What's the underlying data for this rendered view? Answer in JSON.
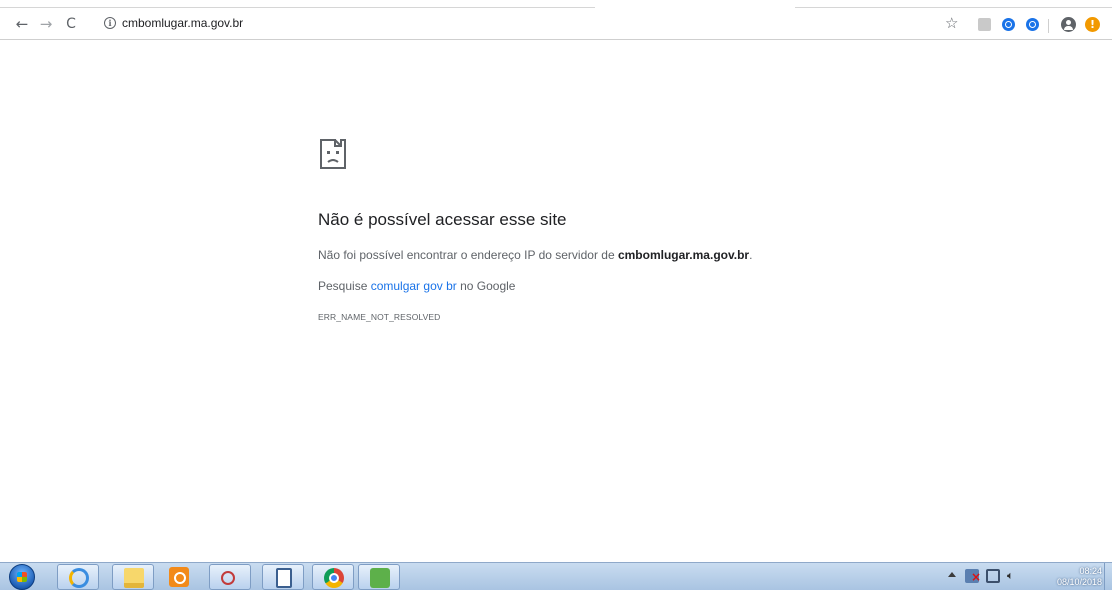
{
  "browser": {
    "url": "cmbomlugar.ma.gov.br",
    "icons": {
      "back": "back-arrow-icon",
      "forward": "forward-arrow-icon",
      "reload": "reload-icon",
      "info": "info-icon",
      "bookmark": "star-icon",
      "profile": "avatar-icon",
      "update": "update-alert-icon"
    },
    "update_badge": "!"
  },
  "error_page": {
    "title": "Não é possível acessar esse site",
    "desc_prefix": "Não foi possível encontrar o endereço IP do servidor de ",
    "desc_domain": "cmbomlugar.ma.gov.br",
    "desc_suffix": ".",
    "search_prefix": "Pesquise ",
    "search_link": "comulgar gov br",
    "search_suffix": " no Google",
    "error_code": "ERR_NAME_NOT_RESOLVED"
  },
  "taskbar": {
    "time": "08:24",
    "date": "08/10/2018",
    "pinned": [
      "start-orb",
      "internet-explorer",
      "file-explorer",
      "outlook",
      "snipping-tool",
      "document",
      "chrome",
      "green-app"
    ]
  },
  "colors": {
    "link": "#1a73e8",
    "text": "#202124",
    "secondary": "#5f6368",
    "alert": "#f29900"
  }
}
